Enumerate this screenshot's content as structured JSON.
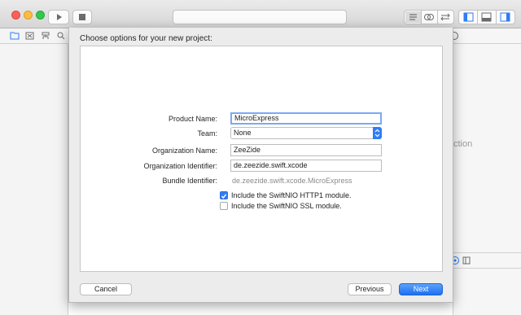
{
  "background": {
    "right_pane_partial_text": "ction"
  },
  "dialog": {
    "title": "Choose options for your new project:",
    "fields": {
      "product_name": {
        "label": "Product Name:",
        "value": "MicroExpress"
      },
      "team": {
        "label": "Team:",
        "value": "None"
      },
      "organization_name": {
        "label": "Organization Name:",
        "value": "ZeeZide"
      },
      "organization_identifier": {
        "label": "Organization Identifier:",
        "value": "de.zeezide.swift.xcode"
      },
      "bundle_identifier": {
        "label": "Bundle Identifier:",
        "value": "de.zeezide.swift.xcode.MicroExpress"
      }
    },
    "options": [
      {
        "label": "Include the SwiftNIO HTTP1 module.",
        "checked": true
      },
      {
        "label": "Include the SwiftNIO SSL module.",
        "checked": false
      }
    ],
    "buttons": {
      "cancel": "Cancel",
      "previous": "Previous",
      "next": "Next"
    }
  },
  "colors": {
    "accent": "#2f7cf6",
    "next_button_top": "#5ea2f8",
    "next_button_bottom": "#1b6ff3"
  },
  "icons": [
    "play-icon",
    "stop-icon",
    "editor-standard-icon",
    "editor-assistant-icon",
    "editor-version-icon",
    "navigator-toggle-icon",
    "debug-toggle-icon",
    "utilities-toggle-icon",
    "folder-icon",
    "source-control-icon",
    "hierarchy-icon",
    "search-icon",
    "help-icon",
    "file-inspector-icon",
    "library-icon"
  ]
}
